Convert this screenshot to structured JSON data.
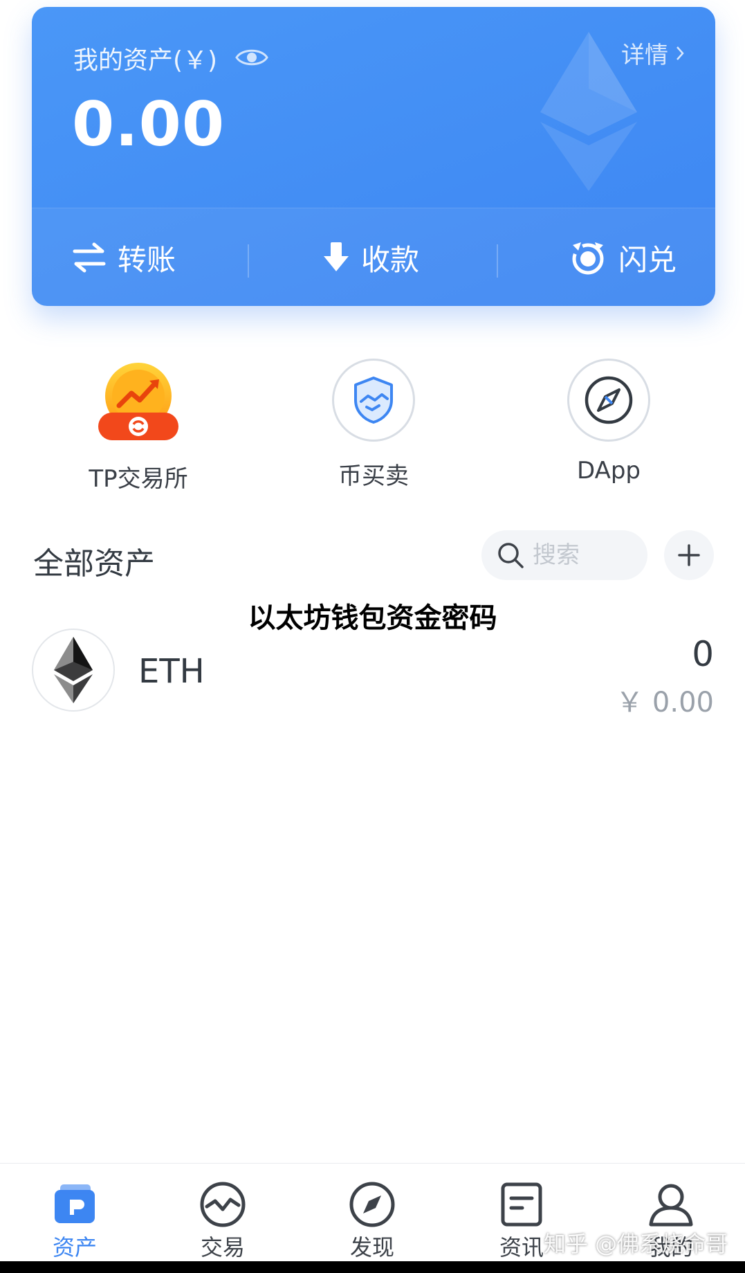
{
  "card": {
    "assets_label": "我的资产(￥)",
    "total_value": "0.00",
    "details_label": "详情",
    "actions": {
      "transfer": "转账",
      "receive": "收款",
      "swap": "闪兑"
    },
    "accent": "#3d86f2"
  },
  "quick_entries": [
    {
      "label": "TP交易所",
      "icon": "tp-exchange-icon"
    },
    {
      "label": "币买卖",
      "icon": "shield-handshake-icon"
    },
    {
      "label": "DApp",
      "icon": "compass-icon"
    }
  ],
  "assets": {
    "title": "全部资产",
    "search_placeholder": "搜索",
    "list": [
      {
        "symbol": "ETH",
        "amount": "0",
        "fiat": "￥ 0.00",
        "icon": "ethereum-icon"
      }
    ]
  },
  "overlay_caption": "以太坊钱包资金密码",
  "tabs": [
    {
      "label": "资产",
      "icon": "wallet-icon",
      "active": true
    },
    {
      "label": "交易",
      "icon": "trade-icon",
      "active": false
    },
    {
      "label": "发现",
      "icon": "compass-icon",
      "active": false
    },
    {
      "label": "资讯",
      "icon": "news-icon",
      "active": false
    },
    {
      "label": "我的",
      "icon": "user-icon",
      "active": false
    }
  ],
  "watermark": "知乎 @佛系烧命哥"
}
